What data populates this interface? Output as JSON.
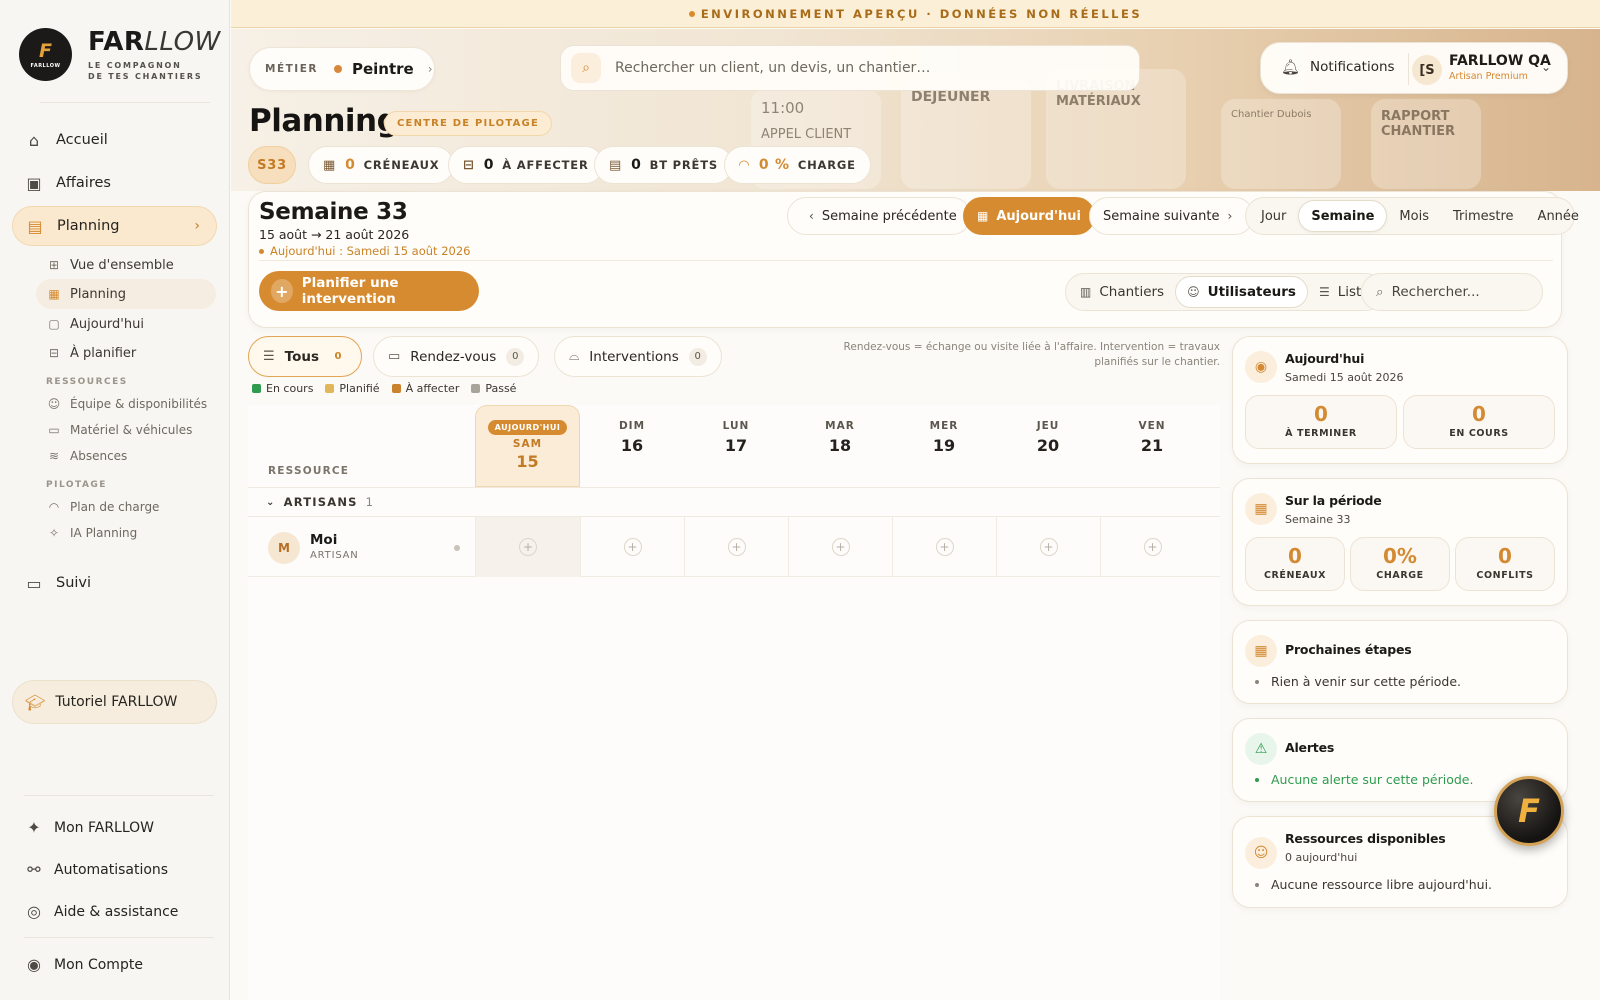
{
  "banner": "ENVIRONNEMENT APERÇU · DONNÉES NON RÉELLES",
  "brand": {
    "name_a": "FAR",
    "name_b": "LLOW",
    "mark": "F",
    "mark_sub": "FARLLOW",
    "tagline1": "LE COMPAGNON",
    "tagline2": "DE TES CHANTIERS"
  },
  "sidebar": {
    "items": [
      {
        "label": "Accueil",
        "icon": "home-icon"
      },
      {
        "label": "Affaires",
        "icon": "briefcase-icon"
      },
      {
        "label": "Planning",
        "icon": "clipboard-icon"
      },
      {
        "label": "Suivi",
        "icon": "folder-icon"
      }
    ],
    "subitems": [
      "Vue d'ensemble",
      "Planning",
      "Aujourd'hui",
      "À planifier"
    ],
    "section_ressources": "RESSOURCES",
    "ressources": [
      "Équipe & disponibilités",
      "Matériel & véhicules",
      "Absences"
    ],
    "section_pilotage": "PILOTAGE",
    "pilotage": [
      "Plan de charge",
      "IA Planning"
    ],
    "tutorial": "Tutoriel FARLLOW",
    "bottom": [
      "Mon FARLLOW",
      "Automatisations",
      "Aide & assistance",
      "Mon Compte"
    ]
  },
  "hero_cards": [
    "11:00",
    "APPEL CLIENT",
    "DEJEUNER",
    "LIVRAISON MATÉRIAUX",
    "Chantier Dubois",
    "RAPPORT CHANTIER"
  ],
  "header": {
    "metier_label": "MÉTIER",
    "metier_value": "Peintre",
    "search_placeholder": "Rechercher un client, un devis, un chantier…",
    "notifications": "Notifications",
    "user_initials": "[S",
    "user_name": "FARLLOW QA",
    "user_role": "Artisan Premium"
  },
  "page": {
    "title": "Planning",
    "badge": "CENTRE DE PILOTAGE",
    "kpis": {
      "week": "S33",
      "creneaux_value": "0",
      "creneaux_label": "CRÉNEAUX",
      "affecter_value": "0",
      "affecter_label": "À AFFECTER",
      "bt_value": "0",
      "bt_label": "BT PRÊTS",
      "charge_value": "0 %",
      "charge_label": "CHARGE"
    }
  },
  "week": {
    "title": "Semaine 33",
    "range": "15 août → 21 août 2026",
    "today": "Aujourd'hui : Samedi 15 août 2026",
    "prev": "Semaine précédente",
    "today_btn": "Aujourd'hui",
    "next": "Semaine suivante",
    "views": [
      "Jour",
      "Semaine",
      "Mois",
      "Trimestre",
      "Année"
    ],
    "plan_btn": "Planifier une intervention",
    "modes": [
      "Chantiers",
      "Utilisateurs",
      "Liste"
    ],
    "search_placeholder": "Rechercher..."
  },
  "filters": {
    "tous": "Tous",
    "tous_count": "0",
    "rdv": "Rendez-vous",
    "rdv_count": "0",
    "interv": "Interventions",
    "interv_count": "0",
    "note": "Rendez-vous = échange ou visite liée à l'affaire. Intervention = travaux planifiés sur le chantier."
  },
  "legend": [
    {
      "label": "En cours",
      "color": "#2e9b4f"
    },
    {
      "label": "Planifié",
      "color": "#e2b65a"
    },
    {
      "label": "À affecter",
      "color": "#c9822d"
    },
    {
      "label": "Passé",
      "color": "#a9a49b"
    }
  ],
  "calendar": {
    "resource_label": "RESSOURCE",
    "today_badge": "AUJOURD'HUI",
    "days": [
      {
        "name": "SAM",
        "num": "15"
      },
      {
        "name": "DIM",
        "num": "16"
      },
      {
        "name": "LUN",
        "num": "17"
      },
      {
        "name": "MAR",
        "num": "18"
      },
      {
        "name": "MER",
        "num": "19"
      },
      {
        "name": "JEU",
        "num": "20"
      },
      {
        "name": "VEN",
        "num": "21"
      }
    ],
    "group": "ARTISANS",
    "group_count": "1",
    "resource": {
      "initial": "M",
      "name": "Moi",
      "role": "ARTISAN"
    }
  },
  "panels": {
    "today": {
      "title": "Aujourd'hui",
      "sub": "Samedi 15 août 2026",
      "a_val": "0",
      "a_lbl": "À TERMINER",
      "b_val": "0",
      "b_lbl": "EN COURS"
    },
    "periode": {
      "title": "Sur la période",
      "sub": "Semaine 33",
      "a_val": "0",
      "a_lbl": "CRÉNEAUX",
      "b_val": "0%",
      "b_lbl": "CHARGE",
      "c_val": "0",
      "c_lbl": "CONFLITS"
    },
    "etapes": {
      "title": "Prochaines étapes",
      "item": "Rien à venir sur cette période."
    },
    "alertes": {
      "title": "Alertes",
      "item": "Aucune alerte sur cette période."
    },
    "ressources": {
      "title": "Ressources disponibles",
      "sub": "0 aujourd'hui",
      "item": "Aucune ressource libre aujourd'hui."
    }
  },
  "fab": "F"
}
